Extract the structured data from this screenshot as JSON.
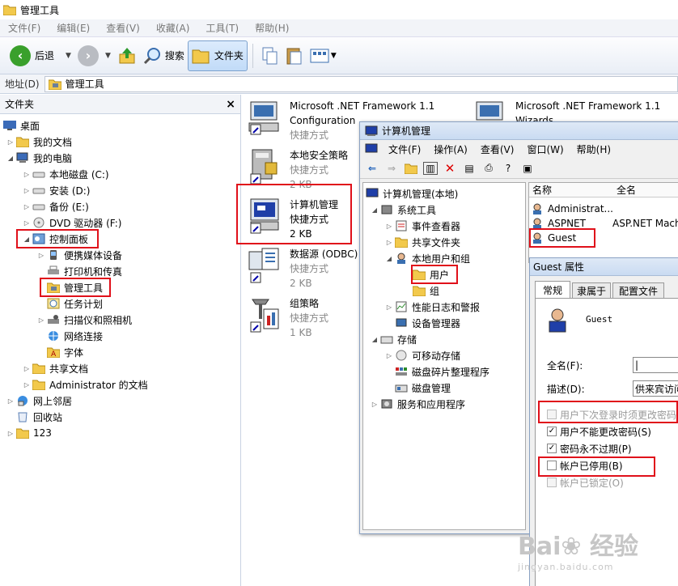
{
  "window": {
    "title": "管理工具"
  },
  "menu": [
    "文件(F)",
    "编辑(E)",
    "查看(V)",
    "收藏(A)",
    "工具(T)",
    "帮助(H)"
  ],
  "toolbar": {
    "back": "后退",
    "search": "搜索",
    "folders": "文件夹"
  },
  "address": {
    "label": "地址(D)",
    "value": "管理工具"
  },
  "folder_pane": {
    "header": "文件夹",
    "close": "×",
    "items": [
      "桌面",
      "我的文档",
      "我的电脑",
      "本地磁盘 (C:)",
      "安装 (D:)",
      "备份 (E:)",
      "DVD 驱动器 (F:)",
      "控制面板",
      "便携媒体设备",
      "打印机和传真",
      "管理工具",
      "任务计划",
      "扫描仪和照相机",
      "网络连接",
      "字体",
      "共享文档",
      "Administrator 的文档",
      "网上邻居",
      "回收站",
      "123"
    ]
  },
  "files": [
    {
      "name1": "Microsoft .NET Framework 1.1",
      "name2": "Configuration",
      "type": "快捷方式"
    },
    {
      "name1": "Microsoft .NET Framework 1.1",
      "name2": "Wizards"
    },
    {
      "name1": "本地安全策略",
      "type": "快捷方式",
      "size": "2 KB"
    },
    {
      "name1": "计算机管理",
      "type": "快捷方式",
      "size": "2 KB"
    },
    {
      "name1": "数据源 (ODBC)",
      "type": "快捷方式",
      "size": "2 KB"
    },
    {
      "name1": "组策略",
      "type": "快捷方式",
      "size": "1 KB"
    }
  ],
  "cm": {
    "title": "计算机管理",
    "menu": [
      "文件(F)",
      "操作(A)",
      "查看(V)",
      "窗口(W)",
      "帮助(H)"
    ],
    "tree": [
      "计算机管理(本地)",
      "系统工具",
      "事件查看器",
      "共享文件夹",
      "本地用户和组",
      "用户",
      "组",
      "性能日志和警报",
      "设备管理器",
      "存储",
      "可移动存储",
      "磁盘碎片整理程序",
      "磁盘管理",
      "服务和应用程序"
    ],
    "list_headers": [
      "名称",
      "全名"
    ],
    "rows": [
      {
        "name": "Administrat...",
        "full": ""
      },
      {
        "name": "ASPNET",
        "full": "ASP.NET Mach"
      },
      {
        "name": "Guest",
        "full": ""
      }
    ]
  },
  "guest": {
    "title": "Guest 属性",
    "tabs": [
      "常规",
      "隶属于",
      "配置文件"
    ],
    "username": "Guest",
    "fullname_label": "全名(F):",
    "fullname_value": "|",
    "desc_label": "描述(D):",
    "desc_value": "供来宾访问",
    "cb1": "用户下次登录时须更改密码",
    "cb2": "用户不能更改密码(S)",
    "cb3": "密码永不过期(P)",
    "cb4": "帐户已停用(B)",
    "cb5": "帐户已锁定(O)"
  },
  "watermark": {
    "brand": "Bai❀ 经验",
    "url": "jingyan.baidu.com"
  },
  "colors": {
    "highlight": "#e0101a",
    "accent": "#316ac5"
  }
}
